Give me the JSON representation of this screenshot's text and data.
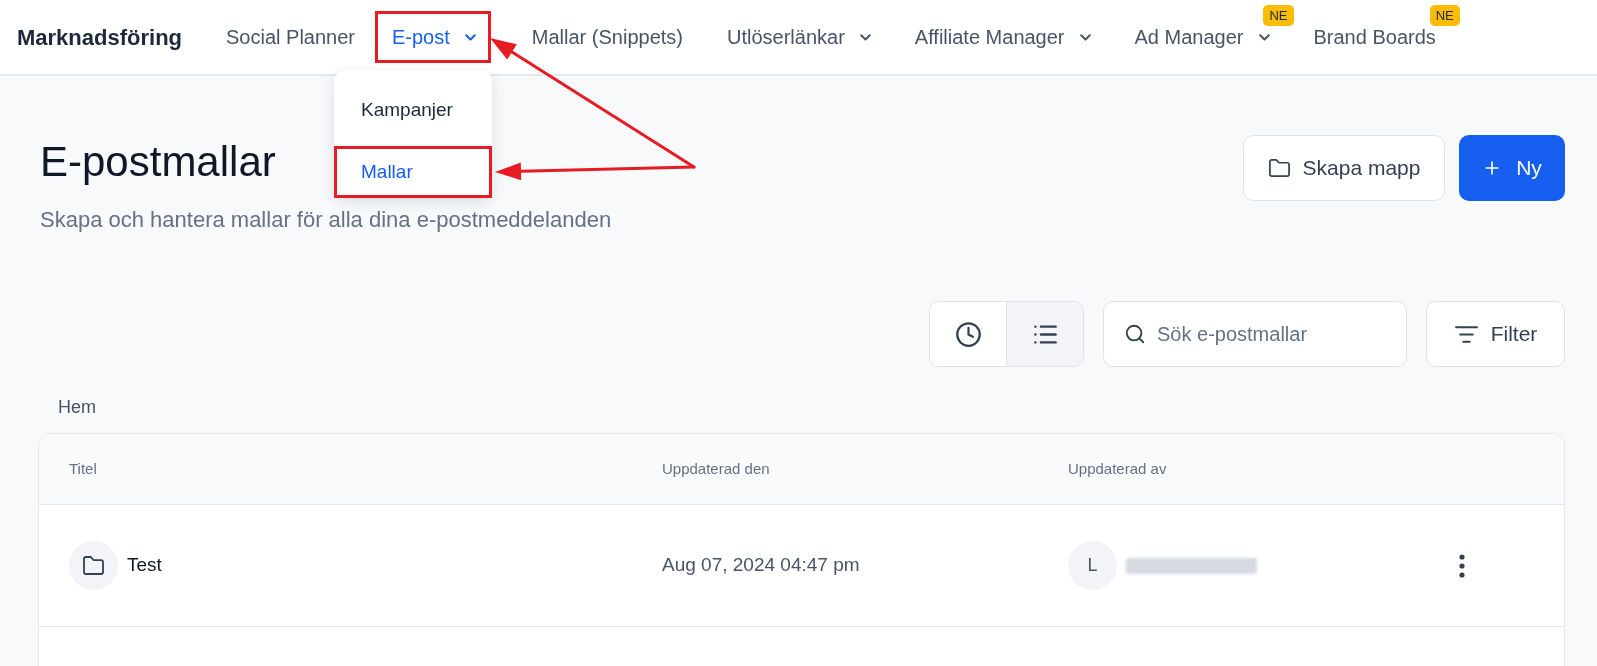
{
  "header": {
    "brand": "Marknadsföring",
    "nav": [
      {
        "label": "Social Planner",
        "selected": false,
        "has_menu": false,
        "highlighted": false
      },
      {
        "label": "E-post",
        "selected": true,
        "has_menu": true,
        "highlighted": true,
        "menu": [
          {
            "label": "Kampanjer",
            "selected": false,
            "highlighted": false
          },
          {
            "label": "Mallar",
            "selected": true,
            "highlighted": true
          }
        ]
      },
      {
        "label": "Mallar (Snippets)",
        "selected": false,
        "has_menu": false,
        "highlighted": false
      },
      {
        "label": "Utlöserlänkar",
        "selected": false,
        "has_menu": true,
        "highlighted": false
      },
      {
        "label": "Affiliate Manager",
        "selected": false,
        "has_menu": true,
        "highlighted": false
      },
      {
        "label": "Ad Manager",
        "selected": false,
        "has_menu": true,
        "highlighted": false,
        "badge": "NE"
      },
      {
        "label": "Brand Boards",
        "selected": false,
        "has_menu": false,
        "highlighted": false,
        "badge": "NE"
      }
    ]
  },
  "page": {
    "title": "E-postmallar",
    "subtitle": "Skapa och hantera mallar för alla dina e-postmeddelanden",
    "actions": [
      {
        "kind": "secondary",
        "label": "Skapa mapp"
      },
      {
        "kind": "primary",
        "label": "Ny"
      }
    ]
  },
  "toolbar": {
    "view_modes": [
      {
        "kind": "recent",
        "selected": false
      },
      {
        "kind": "list",
        "selected": true
      }
    ],
    "search": {
      "placeholder": "Sök e-postmallar"
    },
    "filter_button": "Filter"
  },
  "breadcrumb": "Hem",
  "table": {
    "columns": [
      "Titel",
      "Uppdaterad den",
      "Uppdaterad av"
    ],
    "rows": [
      {
        "kind": "folder",
        "title": "Test",
        "updated_on": "Aug 07, 2024 04:47 pm",
        "updated_by": {
          "initial": "L",
          "redacted": true
        }
      }
    ]
  }
}
